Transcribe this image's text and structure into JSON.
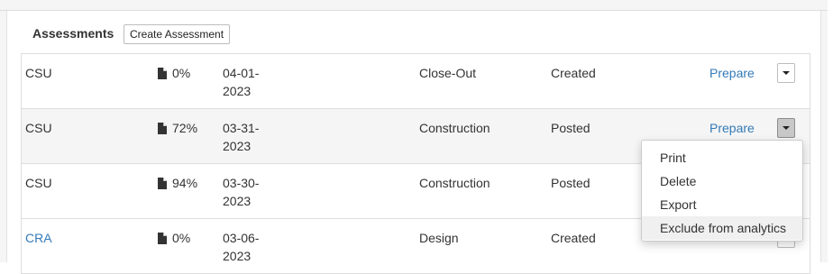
{
  "section": {
    "title": "Assessments",
    "create_label": "Create Assessment"
  },
  "rows": [
    {
      "name": "CSU",
      "pct": "0%",
      "date": "04-01-2023",
      "phase": "Close-Out",
      "status": "Created",
      "action": "Prepare"
    },
    {
      "name": "CSU",
      "pct": "72%",
      "date": "03-31-2023",
      "phase": "Construction",
      "status": "Posted",
      "action": "Prepare"
    },
    {
      "name": "CSU",
      "pct": "94%",
      "date": "03-30-2023",
      "phase": "Construction",
      "status": "Posted",
      "action": ""
    },
    {
      "name": "CRA",
      "pct": "0%",
      "date": "03-06-2023",
      "phase": "Design",
      "status": "Created",
      "action": ""
    }
  ],
  "dropdown": {
    "items": [
      "Print",
      "Delete",
      "Export",
      "Exclude from analytics"
    ]
  },
  "colors": {
    "link": "#337ab7",
    "row_hover": "#f5f5f5",
    "border": "#dddddd"
  }
}
